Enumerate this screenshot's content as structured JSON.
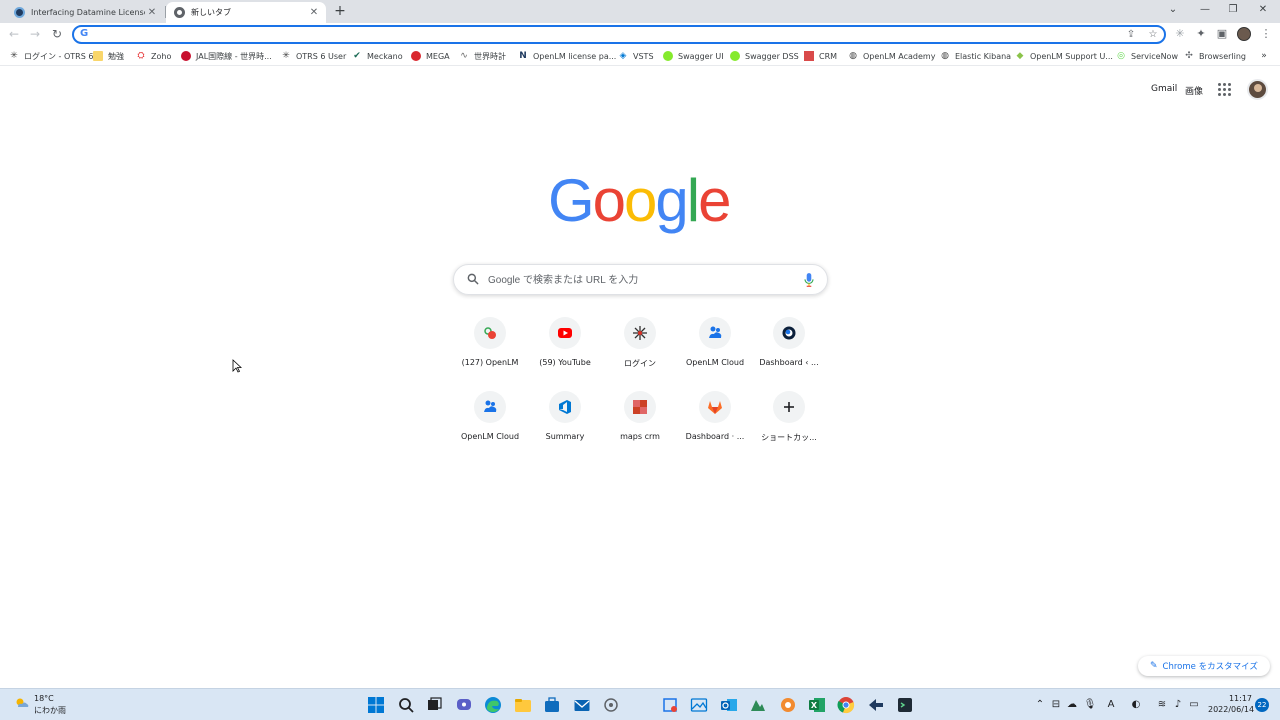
{
  "browser": {
    "tabs": [
      {
        "title": "Interfacing Datamine License Ma",
        "active": false,
        "favicon_color": "#1f3a5f"
      },
      {
        "title": "新しいタブ",
        "active": true,
        "favicon_color": "#5f6368"
      }
    ],
    "omnibox": {
      "value": "",
      "placeholder": ""
    }
  },
  "bookmarks": [
    {
      "label": "ログイン - OTRS 6",
      "icon": "asterisk-icon"
    },
    {
      "label": "勉強",
      "icon": "folder-icon"
    },
    {
      "label": "Zoho",
      "icon": "zoho-icon"
    },
    {
      "label": "JAL国際線 - 世界時...",
      "icon": "jal-icon"
    },
    {
      "label": "OTRS 6 User",
      "icon": "asterisk-icon"
    },
    {
      "label": "Meckano",
      "icon": "check-icon"
    },
    {
      "label": "MEGA",
      "icon": "mega-icon"
    },
    {
      "label": "世界時計",
      "icon": "wave-icon"
    },
    {
      "label": "OpenLM license pa...",
      "icon": "openlm-icon"
    },
    {
      "label": "VSTS",
      "icon": "vsts-icon"
    },
    {
      "label": "Swagger UI",
      "icon": "swagger-icon"
    },
    {
      "label": "Swagger DSS",
      "icon": "swagger-icon"
    },
    {
      "label": "CRM",
      "icon": "crm-icon"
    },
    {
      "label": "OpenLM Academy",
      "icon": "globe-icon"
    },
    {
      "label": "Elastic Kibana",
      "icon": "globe-icon"
    },
    {
      "label": "OpenLM Support U...",
      "icon": "support-icon"
    },
    {
      "label": "ServiceNow",
      "icon": "servicenow-icon"
    },
    {
      "label": "Browserling",
      "icon": "browserling-icon"
    }
  ],
  "ntp": {
    "gmail": "Gmail",
    "images": "画像",
    "search_placeholder": "Google で検索または URL を入力",
    "shortcuts": [
      {
        "label": "(127) OpenLM",
        "icon": "openlm-chat-icon"
      },
      {
        "label": "(59) YouTube",
        "icon": "youtube-icon"
      },
      {
        "label": "ログイン",
        "icon": "asterisk-icon"
      },
      {
        "label": "OpenLM Cloud",
        "icon": "cloud-icon"
      },
      {
        "label": "Dashboard ‹ ...",
        "icon": "ring-icon"
      },
      {
        "label": "OpenLM Cloud",
        "icon": "cloud-icon"
      },
      {
        "label": "Summary",
        "icon": "azure-devops-icon"
      },
      {
        "label": "maps crm",
        "icon": "crm-icon"
      },
      {
        "label": "Dashboard · ...",
        "icon": "gitlab-icon"
      },
      {
        "label": "ショートカッ...",
        "icon": "plus-icon"
      }
    ],
    "customize_label": "Chrome をカスタマイズ"
  },
  "taskbar": {
    "weather_temp": "18°C",
    "weather_desc": "にわか雨",
    "time": "11:17",
    "date": "2022/06/14",
    "notification_count": "22"
  },
  "colors": {
    "accent": "#1a73e8",
    "google_blue": "#4285f4",
    "google_red": "#ea4335",
    "google_yellow": "#fbbc05",
    "google_green": "#34a853"
  }
}
